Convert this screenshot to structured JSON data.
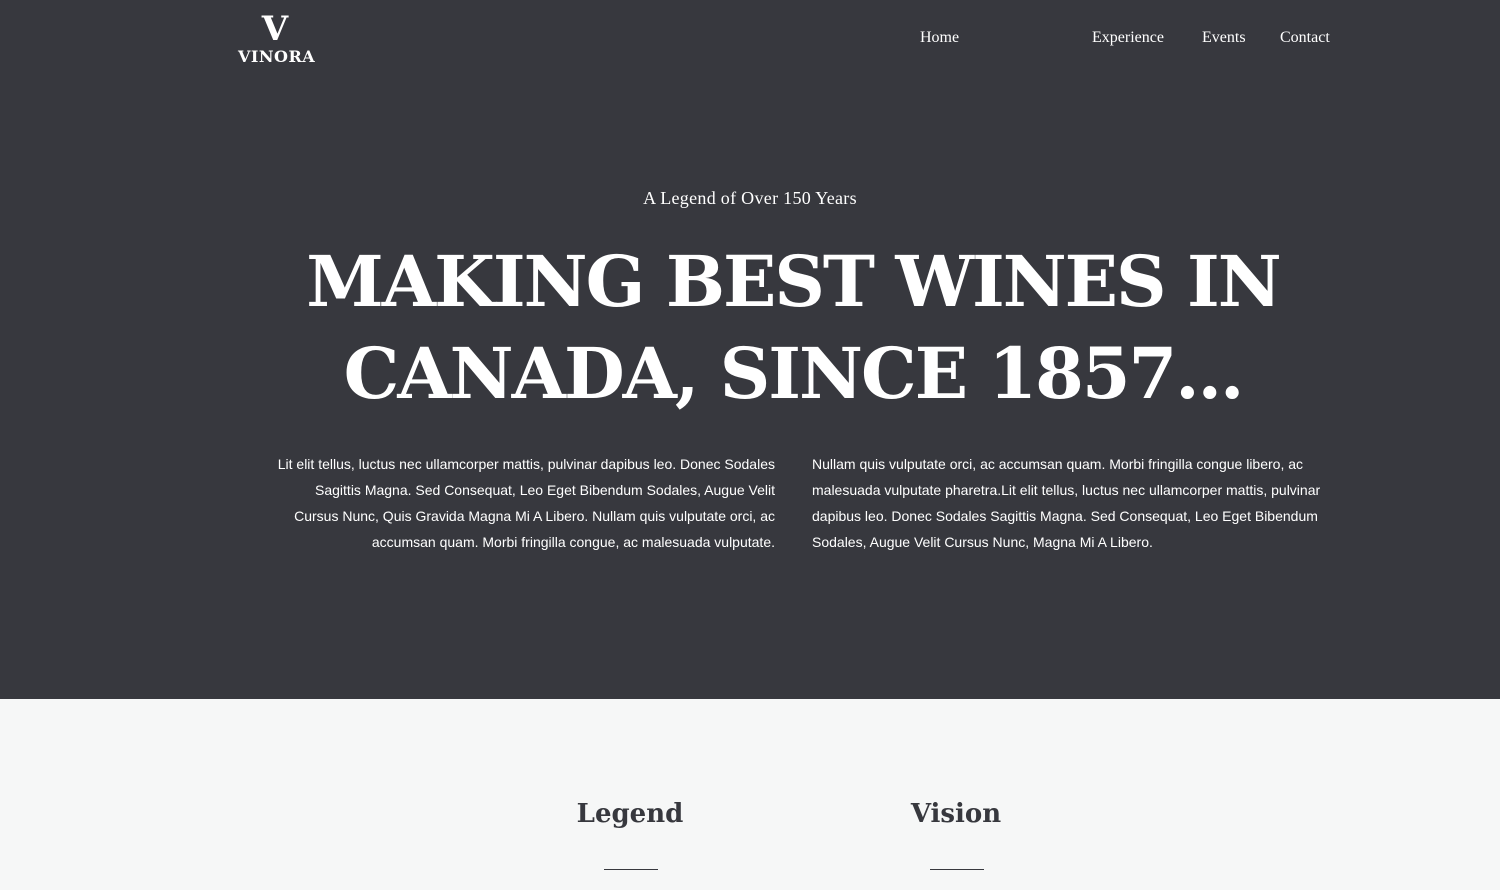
{
  "brand": {
    "mark": "V",
    "name": "VINORA"
  },
  "nav": {
    "items": [
      "Home",
      "Experience",
      "Events",
      "Contact"
    ]
  },
  "hero": {
    "eyebrow": "A Legend of Over 150 Years",
    "headline": "MAKING BEST WINES IN CANADA, SINCE 1857...",
    "paragraph_left": "Lit elit tellus, luctus nec ullamcorper mattis, pulvinar dapibus leo. Donec Sodales Sagittis Magna. Sed Consequat, Leo Eget Bibendum Sodales, Augue Velit Cursus Nunc, Quis Gravida Magna Mi A Libero. Nullam quis vulputate orci, ac accumsan quam. Morbi fringilla congue, ac malesuada vulputate.",
    "paragraph_right": "Nullam quis vulputate orci, ac accumsan quam. Morbi fringilla congue libero, ac malesuada vulputate pharetra.Lit elit tellus, luctus nec ullamcorper mattis, pulvinar dapibus leo. Donec Sodales Sagittis Magna. Sed Consequat, Leo Eget Bibendum Sodales, Augue Velit Cursus Nunc, Magna Mi A Libero."
  },
  "features": {
    "titles": [
      "Legend",
      "Vision"
    ]
  },
  "colors": {
    "hero_bg": "#37383e",
    "page_bg": "#f6f7f7",
    "text_light": "#ffffff",
    "text_dark": "#37383e"
  }
}
